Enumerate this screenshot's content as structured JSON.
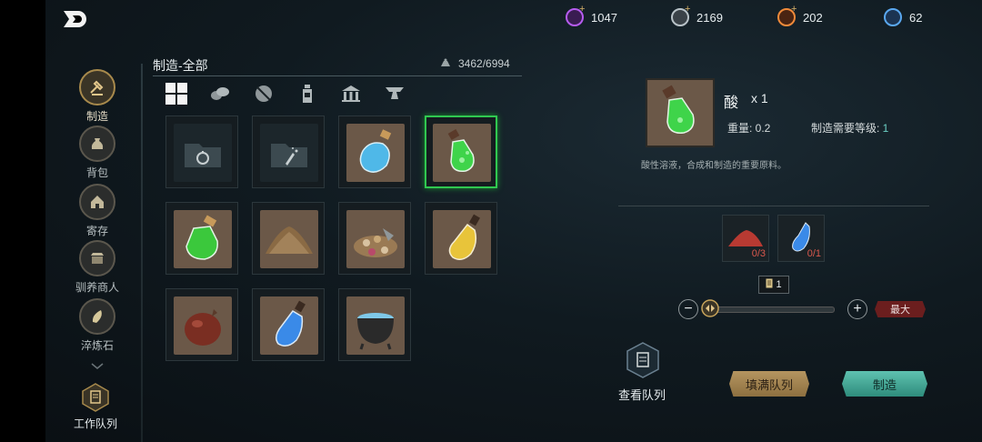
{
  "currencies": [
    {
      "name": "purple-gem",
      "value": "1047",
      "color": "#b65cf0",
      "plus": true
    },
    {
      "name": "silver-coin",
      "value": "2169",
      "color": "#b9c3c8",
      "plus": true
    },
    {
      "name": "orange-gem",
      "value": "202",
      "color": "#f08a3a",
      "plus": true
    },
    {
      "name": "blue-gem",
      "value": "62",
      "color": "#5aa8f0",
      "plus": false
    }
  ],
  "nav": {
    "items": [
      {
        "label": "制造",
        "icon": "craft-hammer-icon",
        "active": true
      },
      {
        "label": "背包",
        "icon": "bag-icon",
        "active": false
      },
      {
        "label": "寄存",
        "icon": "storage-house-icon",
        "active": false
      },
      {
        "label": "驯养商人",
        "icon": "merchant-stall-icon",
        "active": false
      },
      {
        "label": "淬炼石",
        "icon": "refining-stone-icon",
        "active": false
      }
    ],
    "work_queue": "工作队列"
  },
  "panel": {
    "title": "制造-全部",
    "weight": "3462/6994",
    "tabs": [
      "all-grid-icon",
      "materials-icon",
      "ore-icon",
      "potion-icon",
      "building-icon",
      "anvil-icon"
    ]
  },
  "items": [
    {
      "kind": "empty",
      "icon": "folder-flask-icon"
    },
    {
      "kind": "empty",
      "icon": "folder-sparkle-icon"
    },
    {
      "kind": "potion",
      "icon": "blue-bottle-icon",
      "color": "#4fb8e8"
    },
    {
      "kind": "potion",
      "icon": "green-acid-bottle-icon",
      "color": "#3fd44a",
      "selected": true
    },
    {
      "kind": "potion",
      "icon": "green-jar-icon",
      "color": "#3bc83c"
    },
    {
      "kind": "powder",
      "icon": "brown-powder-icon",
      "color": "#8a6a44"
    },
    {
      "kind": "pile",
      "icon": "mixed-seeds-icon",
      "color": "#9a7a54"
    },
    {
      "kind": "potion",
      "icon": "yellow-flask-icon",
      "color": "#e8c43a"
    },
    {
      "kind": "pouch",
      "icon": "red-pouch-icon",
      "color": "#7a2e22"
    },
    {
      "kind": "potion",
      "icon": "blue-flask-icon",
      "color": "#3a8ae8"
    },
    {
      "kind": "cauldron",
      "icon": "cauldron-icon",
      "color": "#7fc8e8"
    }
  ],
  "detail": {
    "name": "酸",
    "qty": "x 1",
    "weight_label": "重量: 0.2",
    "level_label": "制造需要等级: ",
    "level_value": "1",
    "description": "酸性溶液，合成和制造的重要原料。",
    "materials": [
      {
        "icon": "red-powder-icon",
        "count": "0/3",
        "color": "#b83a32"
      },
      {
        "icon": "blue-potion-icon",
        "count": "0/1",
        "color": "#3a8ae8"
      }
    ],
    "quantity": "1",
    "max_label": "最大",
    "view_queue": "查看队列",
    "fill_queue": "填满队列",
    "craft": "制造"
  }
}
